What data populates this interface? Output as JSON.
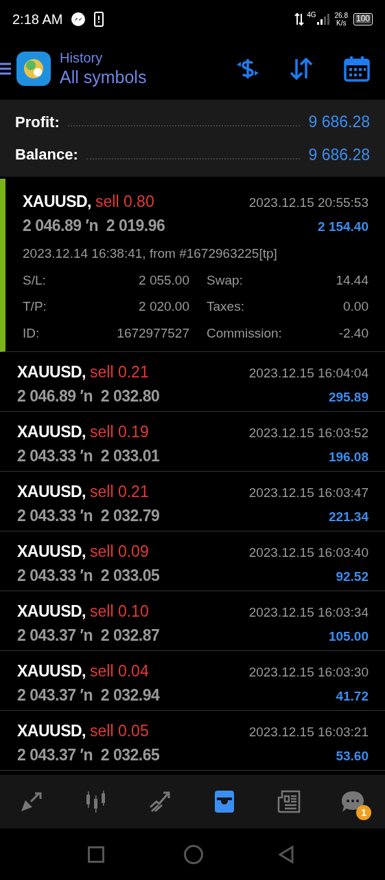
{
  "status_bar": {
    "time": "2:18 AM",
    "network": "4G",
    "speed": "26.8",
    "speed_unit": "K/s",
    "battery": "100"
  },
  "header": {
    "title": "History",
    "subtitle": "All symbols"
  },
  "summary": [
    {
      "label": "Profit:",
      "value": "9 686.28"
    },
    {
      "label": "Balance:",
      "value": "9 686.28"
    }
  ],
  "deals": [
    {
      "symbol": "XAUUSD,",
      "side": "sell 0.80",
      "prices": "2 046.89 ′n  2 019.96",
      "time": "2023.12.15 20:55:53",
      "profit": "2 154.40",
      "expanded": true,
      "details": {
        "opened": "2023.12.14 16:38:41, from #1672963225[tp]",
        "fields": [
          {
            "label": "S/L:",
            "value": "2 055.00",
            "label2": "Swap:",
            "value2": "14.44"
          },
          {
            "label": "T/P:",
            "value": "2 020.00",
            "label2": "Taxes:",
            "value2": "0.00"
          },
          {
            "label": "ID:",
            "value": "1672977527",
            "label2": "Commission:",
            "value2": "-2.40"
          }
        ]
      }
    },
    {
      "symbol": "XAUUSD,",
      "side": "sell 0.21",
      "prices": "2 046.89 ′n  2 032.80",
      "time": "2023.12.15 16:04:04",
      "profit": "295.89",
      "expanded": false
    },
    {
      "symbol": "XAUUSD,",
      "side": "sell 0.19",
      "prices": "2 043.33 ′n  2 033.01",
      "time": "2023.12.15 16:03:52",
      "profit": "196.08",
      "expanded": false
    },
    {
      "symbol": "XAUUSD,",
      "side": "sell 0.21",
      "prices": "2 043.33 ′n  2 032.79",
      "time": "2023.12.15 16:03:47",
      "profit": "221.34",
      "expanded": false
    },
    {
      "symbol": "XAUUSD,",
      "side": "sell 0.09",
      "prices": "2 043.33 ′n  2 033.05",
      "time": "2023.12.15 16:03:40",
      "profit": "92.52",
      "expanded": false
    },
    {
      "symbol": "XAUUSD,",
      "side": "sell 0.10",
      "prices": "2 043.37 ′n  2 032.87",
      "time": "2023.12.15 16:03:34",
      "profit": "105.00",
      "expanded": false
    },
    {
      "symbol": "XAUUSD,",
      "side": "sell 0.04",
      "prices": "2 043.37 ′n  2 032.94",
      "time": "2023.12.15 16:03:30",
      "profit": "41.72",
      "expanded": false
    },
    {
      "symbol": "XAUUSD,",
      "side": "sell 0.05",
      "prices": "2 043.37 ′n  2 032.65",
      "time": "2023.12.15 16:03:21",
      "profit": "53.60",
      "expanded": false
    }
  ],
  "bottom_nav": [
    {
      "kind": "quotes",
      "selected": false
    },
    {
      "kind": "chart",
      "selected": false
    },
    {
      "kind": "trade",
      "selected": false
    },
    {
      "kind": "history",
      "selected": true
    },
    {
      "kind": "news",
      "selected": false
    },
    {
      "kind": "messages",
      "selected": false,
      "badge": "1"
    }
  ]
}
